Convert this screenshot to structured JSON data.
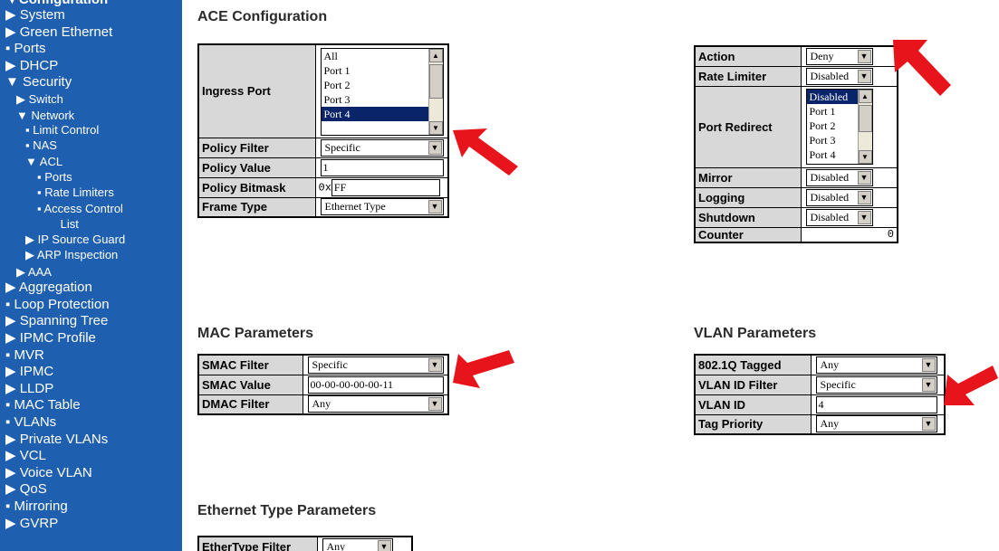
{
  "sidebar": {
    "top_item": "Configuration",
    "items": [
      {
        "label": "System",
        "marker": "▶",
        "level": 1
      },
      {
        "label": "Green Ethernet",
        "marker": "▶",
        "level": 1
      },
      {
        "label": "Ports",
        "marker": "▪",
        "level": 1
      },
      {
        "label": "DHCP",
        "marker": "▶",
        "level": 1
      },
      {
        "label": "Security",
        "marker": "▼",
        "level": 1
      },
      {
        "label": "Switch",
        "marker": "▶",
        "level": 2
      },
      {
        "label": "Network",
        "marker": "▼",
        "level": 2
      },
      {
        "label": "Limit Control",
        "marker": "▪",
        "level": 3
      },
      {
        "label": "NAS",
        "marker": "▪",
        "level": 3
      },
      {
        "label": "ACL",
        "marker": "▼",
        "level": 3
      },
      {
        "label": "Ports",
        "marker": "▪",
        "level": 4
      },
      {
        "label": "Rate Limiters",
        "marker": "▪",
        "level": 4
      },
      {
        "label": "Access Control",
        "marker": "▪",
        "level": 4
      },
      {
        "label": "List",
        "marker": "",
        "level": 5
      },
      {
        "label": "IP Source Guard",
        "marker": "▶",
        "level": 3
      },
      {
        "label": "ARP Inspection",
        "marker": "▶",
        "level": 3
      },
      {
        "label": "AAA",
        "marker": "▶",
        "level": 2
      },
      {
        "label": "Aggregation",
        "marker": "▶",
        "level": 1
      },
      {
        "label": "Loop Protection",
        "marker": "▪",
        "level": 1
      },
      {
        "label": "Spanning Tree",
        "marker": "▶",
        "level": 1
      },
      {
        "label": "IPMC Profile",
        "marker": "▶",
        "level": 1
      },
      {
        "label": "MVR",
        "marker": "▪",
        "level": 1
      },
      {
        "label": "IPMC",
        "marker": "▶",
        "level": 1
      },
      {
        "label": "LLDP",
        "marker": "▶",
        "level": 1
      },
      {
        "label": "MAC Table",
        "marker": "▪",
        "level": 1
      },
      {
        "label": "VLANs",
        "marker": "▪",
        "level": 1
      },
      {
        "label": "Private VLANs",
        "marker": "▶",
        "level": 1
      },
      {
        "label": "VCL",
        "marker": "▶",
        "level": 1
      },
      {
        "label": "Voice VLAN",
        "marker": "▶",
        "level": 1
      },
      {
        "label": "QoS",
        "marker": "▶",
        "level": 1
      },
      {
        "label": "Mirroring",
        "marker": "▪",
        "level": 1
      },
      {
        "label": "GVRP",
        "marker": "▶",
        "level": 1
      }
    ]
  },
  "headings": {
    "ace": "ACE Configuration",
    "mac": "MAC Parameters",
    "vlan": "VLAN Parameters",
    "ethertype": "Ethernet Type Parameters"
  },
  "ace": {
    "ingress_port": {
      "label": "Ingress Port",
      "options": [
        "All",
        "Port 1",
        "Port 2",
        "Port 3",
        "Port 4"
      ],
      "selected": "Port 4"
    },
    "policy_filter": {
      "label": "Policy Filter",
      "value": "Specific"
    },
    "policy_value": {
      "label": "Policy Value",
      "value": "1"
    },
    "policy_bitmask": {
      "label": "Policy Bitmask",
      "prefix": "0x",
      "value": "FF"
    },
    "frame_type": {
      "label": "Frame Type",
      "value": "Ethernet Type"
    }
  },
  "action": {
    "action": {
      "label": "Action",
      "value": "Deny"
    },
    "rate_limiter": {
      "label": "Rate Limiter",
      "value": "Disabled"
    },
    "port_redirect": {
      "label": "Port Redirect",
      "options": [
        "Disabled",
        "Port 1",
        "Port 2",
        "Port 3",
        "Port 4"
      ],
      "selected": "Disabled"
    },
    "mirror": {
      "label": "Mirror",
      "value": "Disabled"
    },
    "logging": {
      "label": "Logging",
      "value": "Disabled"
    },
    "shutdown": {
      "label": "Shutdown",
      "value": "Disabled"
    },
    "counter": {
      "label": "Counter",
      "value": "0"
    }
  },
  "mac": {
    "smac_filter": {
      "label": "SMAC Filter",
      "value": "Specific"
    },
    "smac_value": {
      "label": "SMAC Value",
      "value": "00-00-00-00-00-11"
    },
    "dmac_filter": {
      "label": "DMAC Filter",
      "value": "Any"
    }
  },
  "vlan": {
    "tagged": {
      "label": "802.1Q Tagged",
      "value": "Any"
    },
    "vid_filter": {
      "label": "VLAN ID Filter",
      "value": "Specific"
    },
    "vid": {
      "label": "VLAN ID",
      "value": "4"
    },
    "tag_priority": {
      "label": "Tag Priority",
      "value": "Any"
    }
  },
  "ethertype": {
    "filter": {
      "label": "EtherType Filter",
      "value": "Any"
    }
  },
  "colors": {
    "sidebar_bg": "#1f5fb0",
    "label_bg": "#d8d8d8",
    "selected_bg": "#0a246a",
    "annotation_arrow": "#e8141b"
  },
  "icons": {
    "dropdown": "triangle-down-icon",
    "annotation": "red-arrow-icon"
  }
}
